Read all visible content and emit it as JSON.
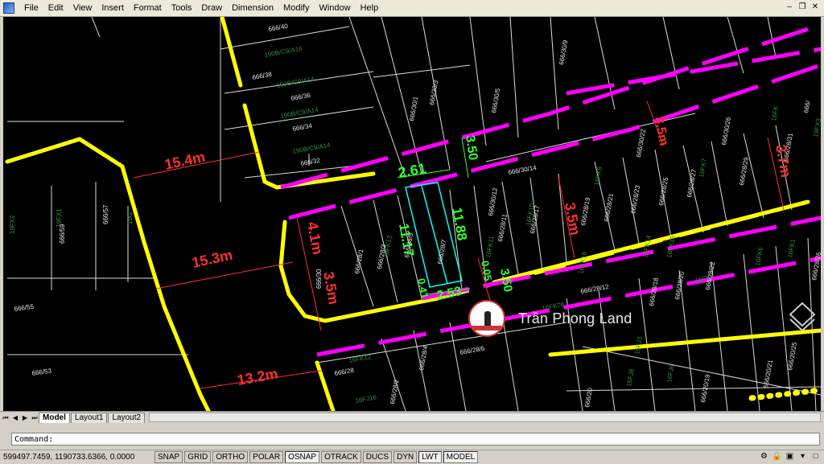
{
  "menu": [
    "File",
    "Edit",
    "View",
    "Insert",
    "Format",
    "Tools",
    "Draw",
    "Dimension",
    "Modify",
    "Window",
    "Help"
  ],
  "window_controls": {
    "minimize": "–",
    "restore": "❐",
    "close": "✕"
  },
  "labels": {
    "lot_ids": [
      "666/40",
      "190B/C9/A16",
      "666/38",
      "190B/C9/A14",
      "666/36",
      "190B/C9/A14",
      "666/34",
      "190B/C9/A14",
      "666/32",
      "666/59",
      "666/57",
      "666/55",
      "666/53",
      "666/30",
      "666/30/1",
      "666/30/3",
      "666/30/5",
      "666/30/9",
      "666/30/14",
      "666/30/12",
      "666/30/22",
      "666/30/26",
      "666/28/1",
      "666/28/3",
      "666/28/5",
      "666/28/7",
      "666/28/11",
      "666/28/17",
      "666/28/19",
      "666/28/21",
      "666/28/23",
      "666/28/25",
      "666/28/27",
      "666/28/29",
      "666/28/31",
      "666/28/12",
      "666/28/18",
      "666/28/20",
      "666/28/22",
      "666/28/26",
      "666/28/6",
      "666/28",
      "666/28/2",
      "666/28/4",
      "666/20/25",
      "666/20/21",
      "666/20/19",
      "666/20",
      "16FK6",
      "16FK7",
      "16FK8",
      "16FK9",
      "16FK10",
      "16FK11",
      "16FK12",
      "16FK13",
      "16FK78",
      "16FJ16",
      "16FJ8",
      "16FJ6",
      "666/"
    ],
    "road_dims": [
      "15.4m",
      "15.3m",
      "13.2m",
      "4.1m",
      "3.5m",
      "3.5m",
      "3.5m",
      "3.7m"
    ],
    "lot_dims": [
      "2.61",
      "3.50",
      "11.17",
      "11.88",
      "2.53",
      "0.05",
      "0.41",
      "3.50"
    ],
    "partial_ids": [
      "19FX2",
      "19FX1",
      "19G",
      "19FX3",
      "16FK1",
      "16FK14",
      "16FK15",
      "16FK16",
      "16FJ3",
      "16FK"
    ]
  },
  "watermark": {
    "text": "Trần Phong Land"
  },
  "tabs": {
    "nav": [
      "⏮",
      "◀",
      "▶",
      "⏭"
    ],
    "items": [
      "Model",
      "Layout1",
      "Layout2"
    ],
    "active": "Model"
  },
  "command": {
    "prompt": "Command:"
  },
  "status": {
    "coords": "599497.7459, 1190733.6366, 0.0000",
    "toggles": [
      "SNAP",
      "GRID",
      "ORTHO",
      "POLAR",
      "OSNAP",
      "OTRACK",
      "DUCS",
      "DYN",
      "LWT",
      "MODEL"
    ],
    "active_toggles": [
      "OSNAP",
      "LWT",
      "MODEL"
    ]
  },
  "colors": {
    "road": "#ffff00",
    "boundary": "#ff00ff",
    "dim": "#ff3030",
    "lotdim": "#33ff33",
    "hatch": "#00ffff",
    "text": "#e6e6e6",
    "label": "#2f8f3a"
  }
}
